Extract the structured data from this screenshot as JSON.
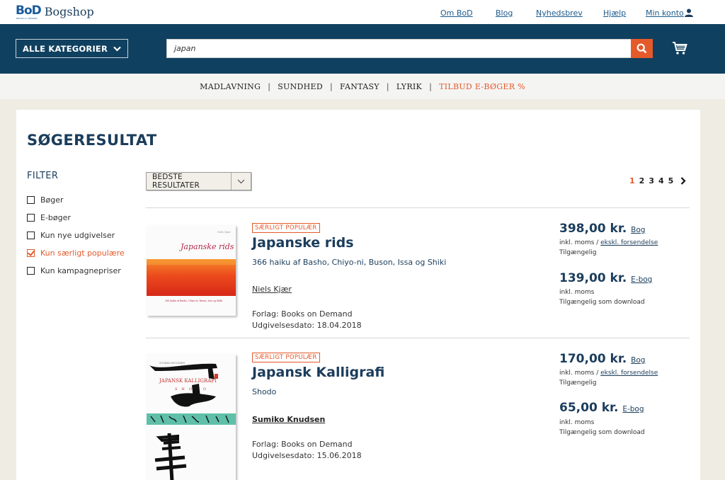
{
  "brand": {
    "logo": "BoD",
    "logo_sub": "BOOKS on DEMAND",
    "name": "Bogshop"
  },
  "toplinks": [
    "Om BoD",
    "Blog",
    "Nyhedsbrev",
    "Hjælp",
    "Min konto"
  ],
  "header": {
    "categories_label": "ALLE KATEGORIER",
    "search_value": "japan"
  },
  "catnav": [
    "MADLAVNING",
    "SUNDHED",
    "FANTASY",
    "LYRIK",
    "TILBUD E-BØGER %"
  ],
  "page": {
    "title": "SØGERESULTAT"
  },
  "filter": {
    "title": "FILTER",
    "items": [
      {
        "label": "Bøger",
        "checked": false
      },
      {
        "label": "E-bøger",
        "checked": false
      },
      {
        "label": "Kun nye udgivelser",
        "checked": false
      },
      {
        "label": "Kun særligt populære",
        "checked": true
      },
      {
        "label": "Kun kampagnepriser",
        "checked": false
      }
    ]
  },
  "sort": {
    "selected": "BEDSTE RESULTATER"
  },
  "pager": {
    "pages": [
      "1",
      "2",
      "3",
      "4",
      "5"
    ],
    "active": "1"
  },
  "results": [
    {
      "badge": "SÆRLIGT POPULÆR",
      "title": "Japanske rids",
      "subtitle": "366 haiku af Basho, Chiyo-ni, Buson, Issa og Shiki",
      "author": "Niels Kjær",
      "publisher": "Forlag: Books on Demand",
      "date": "Udgivelsesdato: 18.04.2018",
      "cover": {
        "title": "Japanske rids",
        "author": "Niels Kjær",
        "sub": "366 haiku af Basho, Chiyo-ni, Buson, Issa og Shiki"
      },
      "prices": [
        {
          "amount": "398,00 kr.",
          "type": "Bog",
          "note1": "inkl. moms / ",
          "note1_link": "ekskl. forsendelse",
          "note2": "Tilgængelig"
        },
        {
          "amount": "139,00 kr.",
          "type": "E-bog",
          "note1": "inkl. moms",
          "note1_link": "",
          "note2": "Tilgængelig som download"
        }
      ]
    },
    {
      "badge": "SÆRLIGT POPULÆR",
      "title": "Japansk Kalligrafi",
      "subtitle": "Shodo",
      "author": "Sumiko Knudsen",
      "publisher": "Forlag: Books on Demand",
      "date": "Udgivelsesdato: 15.06.2018",
      "cover": {
        "author": "SUMIKO KNUDSEN",
        "title": "JAPANSK KALLIGRAFI",
        "sub": "SHODO"
      },
      "prices": [
        {
          "amount": "170,00 kr.",
          "type": "Bog",
          "note1": "inkl. moms / ",
          "note1_link": "ekskl. forsendelse",
          "note2": "Tilgængelig"
        },
        {
          "amount": "65,00 kr.",
          "type": "E-bog",
          "note1": "inkl. moms",
          "note1_link": "",
          "note2": "Tilgængelig som download"
        }
      ]
    }
  ],
  "colors": {
    "navy": "#10405f",
    "accent": "#e45a2b",
    "title": "#1b3d5c",
    "bg": "#eeece3"
  },
  "icons": [
    "user-icon",
    "chevron-down-icon",
    "search-icon",
    "cart-icon",
    "chevron-right-icon",
    "checkbox-icon"
  ]
}
